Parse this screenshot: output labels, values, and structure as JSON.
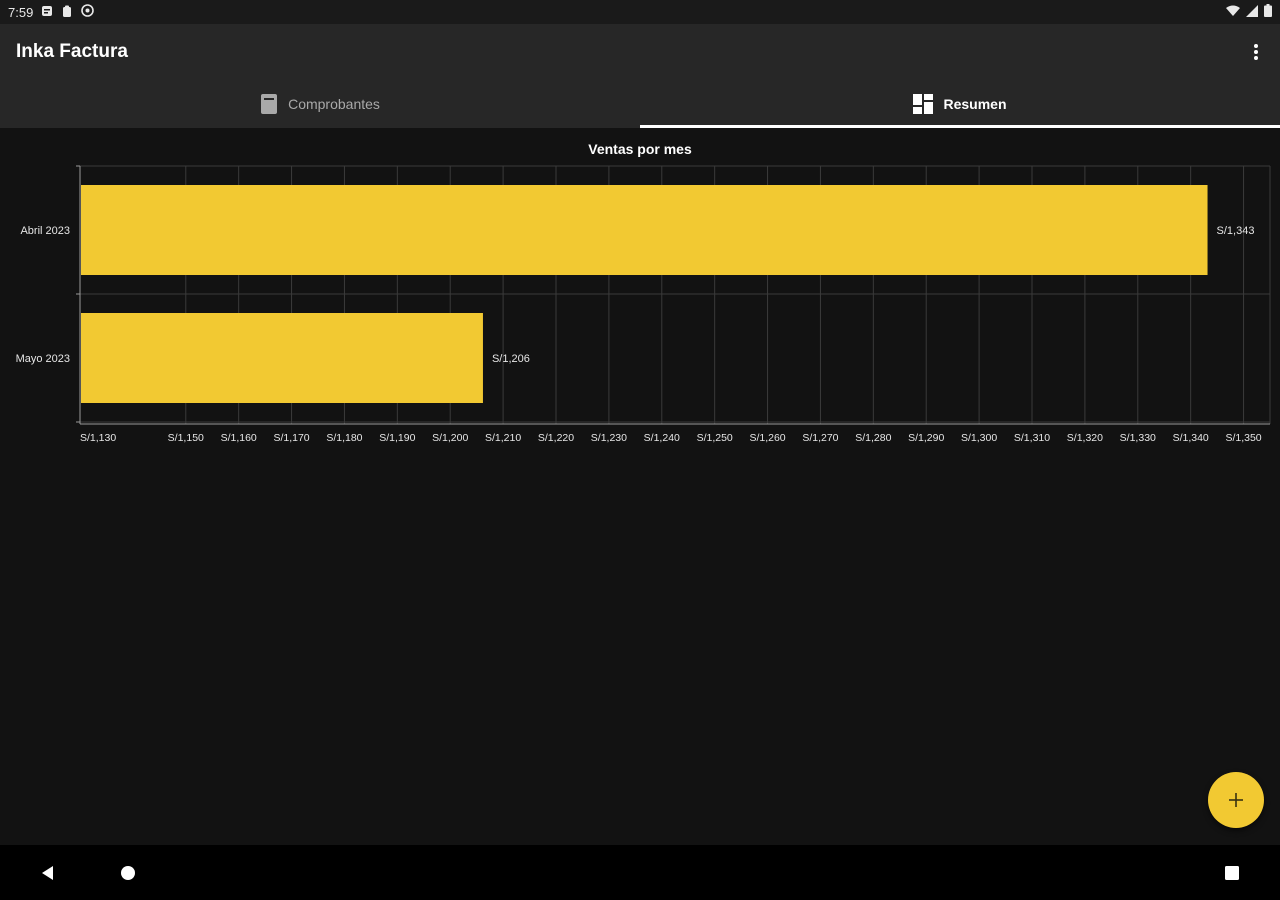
{
  "status_bar": {
    "time": "7:59",
    "icons": [
      "notification-icon",
      "clipboard-icon",
      "sync-icon"
    ],
    "right_icons": [
      "wifi-icon",
      "signal-icon",
      "battery-icon"
    ]
  },
  "app": {
    "title": "Inka Factura"
  },
  "tabs": [
    {
      "label": "Comprobantes",
      "icon": "receipt-icon",
      "active": false
    },
    {
      "label": "Resumen",
      "icon": "dashboard-icon",
      "active": true
    }
  ],
  "accent": "#f2c932",
  "chart_data": {
    "type": "bar",
    "orientation": "horizontal",
    "title": "Ventas por mes",
    "categories": [
      "Abril 2023",
      "Mayo 2023"
    ],
    "values": [
      1343,
      1206
    ],
    "value_labels": [
      "S/1,343",
      "S/1,206"
    ],
    "xlim": [
      1130,
      1355
    ],
    "ticks": [
      1130,
      1150,
      1160,
      1170,
      1180,
      1190,
      1200,
      1210,
      1220,
      1230,
      1240,
      1250,
      1260,
      1270,
      1280,
      1290,
      1300,
      1310,
      1320,
      1330,
      1340,
      1350
    ],
    "tick_labels": [
      "S/1,130",
      "S/1,150",
      "S/1,160",
      "S/1,170",
      "S/1,180",
      "S/1,190",
      "S/1,200",
      "S/1,210",
      "S/1,220",
      "S/1,230",
      "S/1,240",
      "S/1,250",
      "S/1,260",
      "S/1,270",
      "S/1,280",
      "S/1,290",
      "S/1,300",
      "S/1,310",
      "S/1,320",
      "S/1,330",
      "S/1,340",
      "S/1,350"
    ],
    "grid": true,
    "color": "#f2c932"
  },
  "fab": {
    "icon": "add-icon"
  },
  "nav": {
    "icons": [
      "back-icon",
      "home-icon",
      "recents-icon"
    ]
  }
}
